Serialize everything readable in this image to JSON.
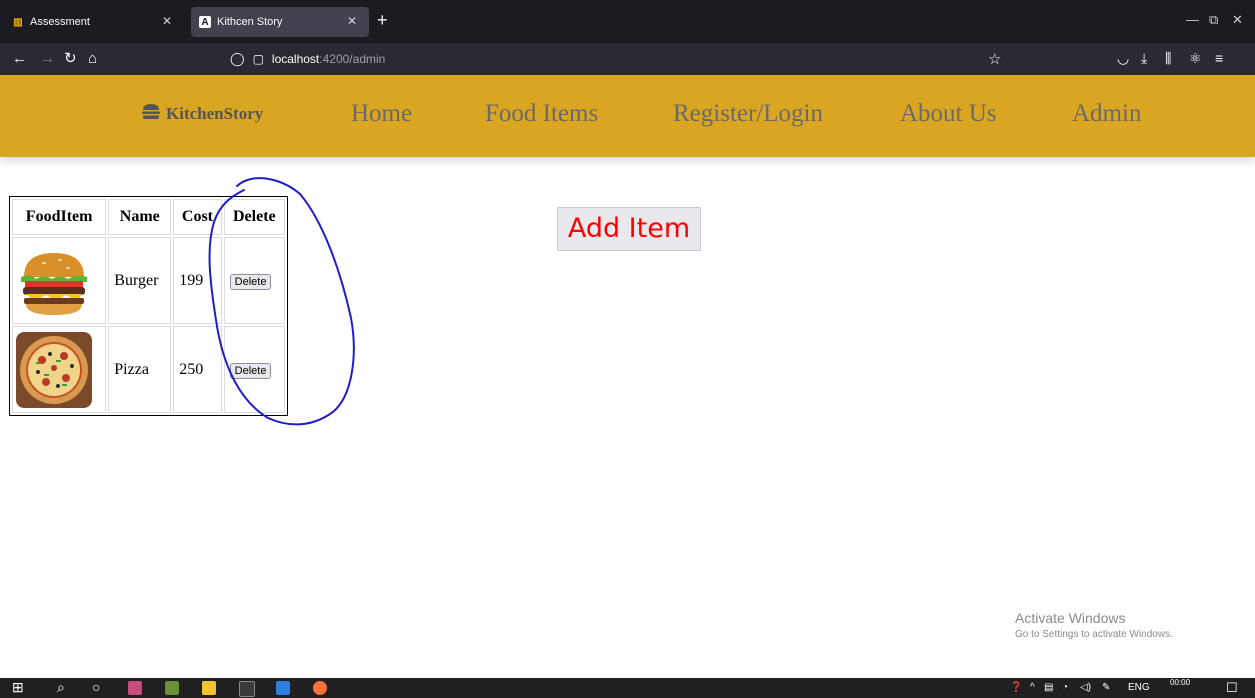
{
  "browser": {
    "tabs": [
      {
        "title": "Assessment",
        "favicon": "git-icon"
      },
      {
        "title": "Kithcen Story",
        "favicon": "angular-icon",
        "favicon_letter": "A",
        "active": true
      }
    ],
    "url_host": "localhost",
    "url_path": ":4200/admin"
  },
  "site": {
    "brand": "KitchenStory",
    "brand_icon": "burger-icon",
    "nav": [
      "Home",
      "Food Items",
      "Register/Login",
      "About Us",
      "Admin"
    ]
  },
  "admin": {
    "table": {
      "headers": [
        "FoodItem",
        "Name",
        "Cost",
        "Delete"
      ],
      "rows": [
        {
          "image": "burger",
          "name": "Burger",
          "cost": "199",
          "action": "Delete"
        },
        {
          "image": "pizza",
          "name": "Pizza",
          "cost": "250",
          "action": "Delete"
        }
      ]
    },
    "add_button": "Add Item"
  },
  "watermark": {
    "title": "Activate Windows",
    "subtitle": "Go to Settings to activate Windows."
  },
  "taskbar": {
    "language": "ENG",
    "time": "00:00"
  },
  "colors": {
    "header_bg": "#daa520",
    "add_button_text": "#ff0000",
    "annotation_ink": "#1e1ec8"
  }
}
